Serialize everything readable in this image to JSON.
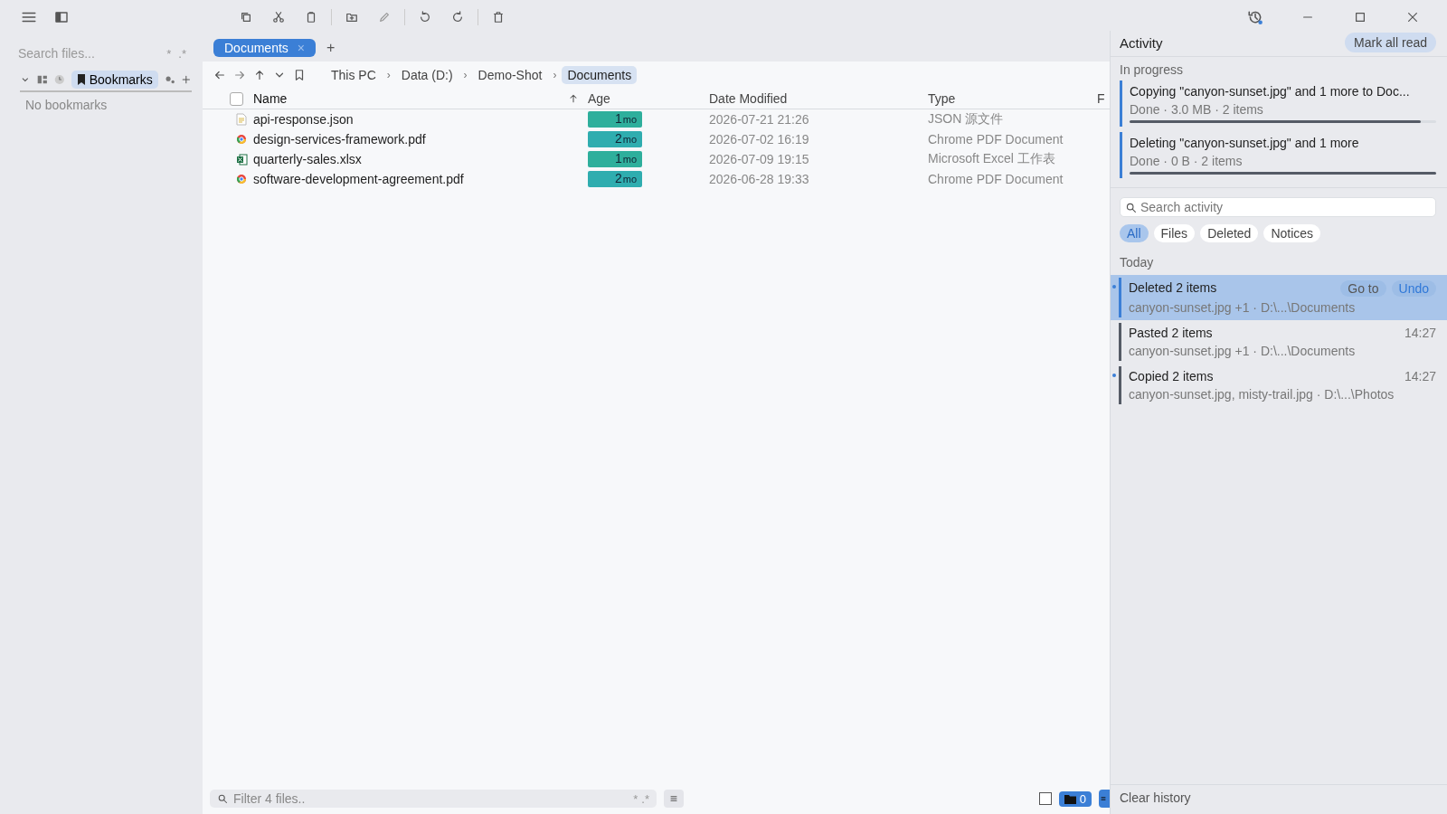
{
  "sidebar": {
    "search": {
      "placeholder": "Search files..."
    },
    "search_toggles": [
      "*",
      ".*"
    ],
    "bookmarks": {
      "expanded": true,
      "tab_label": "Bookmarks",
      "empty_text": "No bookmarks"
    }
  },
  "tabs": [
    {
      "label": "Documents",
      "selected": true,
      "close": "×"
    }
  ],
  "new_tab": "+",
  "breadcrumb_separator": "›",
  "breadcrumb": [
    {
      "label": "This PC",
      "selected": false
    },
    {
      "label": "Data (D:)",
      "selected": false
    },
    {
      "label": "Demo-Shot",
      "selected": false
    },
    {
      "label": "Documents",
      "selected": true
    }
  ],
  "table": {
    "select_all_checked": false,
    "columns": [
      {
        "label": "Name",
        "sorted": true
      },
      {
        "label": "Age",
        "sorted": false
      },
      {
        "label": "Date Modified",
        "sorted": false
      },
      {
        "label": "Type",
        "sorted": false
      },
      {
        "label": "F",
        "sorted": false
      }
    ],
    "rows": [
      {
        "kind": "json",
        "name": "api-response.json",
        "age": "1",
        "age_unit": "mo",
        "modified": "2026-07-21 21:26",
        "type": "JSON 源文件",
        "color": "#2eaf9c"
      },
      {
        "kind": "pdf",
        "name": "design-services-framework.pdf",
        "age": "2",
        "age_unit": "mo",
        "modified": "2026-07-02 16:19",
        "type": "Chrome PDF Document",
        "color": "#2fadaf"
      },
      {
        "kind": "excel",
        "name": "quarterly-sales.xlsx",
        "age": "1",
        "age_unit": "mo",
        "modified": "2026-07-09 19:15",
        "type": "Microsoft Excel 工作表",
        "color": "#2eaf9c"
      },
      {
        "kind": "pdf",
        "name": "software-development-agreement.pdf",
        "age": "2",
        "age_unit": "mo",
        "modified": "2026-06-28 19:33",
        "type": "Chrome PDF Document",
        "color": "#2fadaf"
      }
    ]
  },
  "filter": {
    "placeholder": "Filter 4 files..",
    "toggles": [
      "*",
      ".*"
    ]
  },
  "status": {
    "select_checked": false,
    "folder_count": "0"
  },
  "activity": {
    "title": "Activity",
    "mark_all_read": "Mark all read",
    "in_progress_label": "In progress",
    "in_progress": [
      {
        "title": "Copying \"canyon-sunset.jpg\" and 1 more to Doc...",
        "detail": "Done · 3.0 MB · 2 items",
        "level": 0.95
      },
      {
        "title": "Deleting \"canyon-sunset.jpg\" and 1 more",
        "detail": "Done · 0 B · 2 items",
        "level": 1
      }
    ],
    "search": {
      "placeholder": "Search activity"
    },
    "filters": [
      {
        "label": "All",
        "selected": true
      },
      {
        "label": "Files",
        "selected": false
      },
      {
        "label": "Deleted",
        "selected": false
      },
      {
        "label": "Notices",
        "selected": false
      }
    ],
    "group_label": "Today",
    "items": [
      {
        "title": "Deleted 2 items",
        "detail": "canyon-sunset.jpg +1 · D:\\...\\Documents",
        "selected": true,
        "unread": true,
        "actions": [
          "Go to",
          "Undo"
        ]
      },
      {
        "title": "Pasted 2 items",
        "detail": "canyon-sunset.jpg +1 · D:\\...\\Documents",
        "time": "14:27",
        "selected": false,
        "unread": false
      },
      {
        "title": "Copied 2 items",
        "detail": "canyon-sunset.jpg, misty-trail.jpg · D:\\...\\Photos",
        "time": "14:27",
        "selected": false,
        "unread": true
      }
    ],
    "clear_history": "Clear history"
  }
}
